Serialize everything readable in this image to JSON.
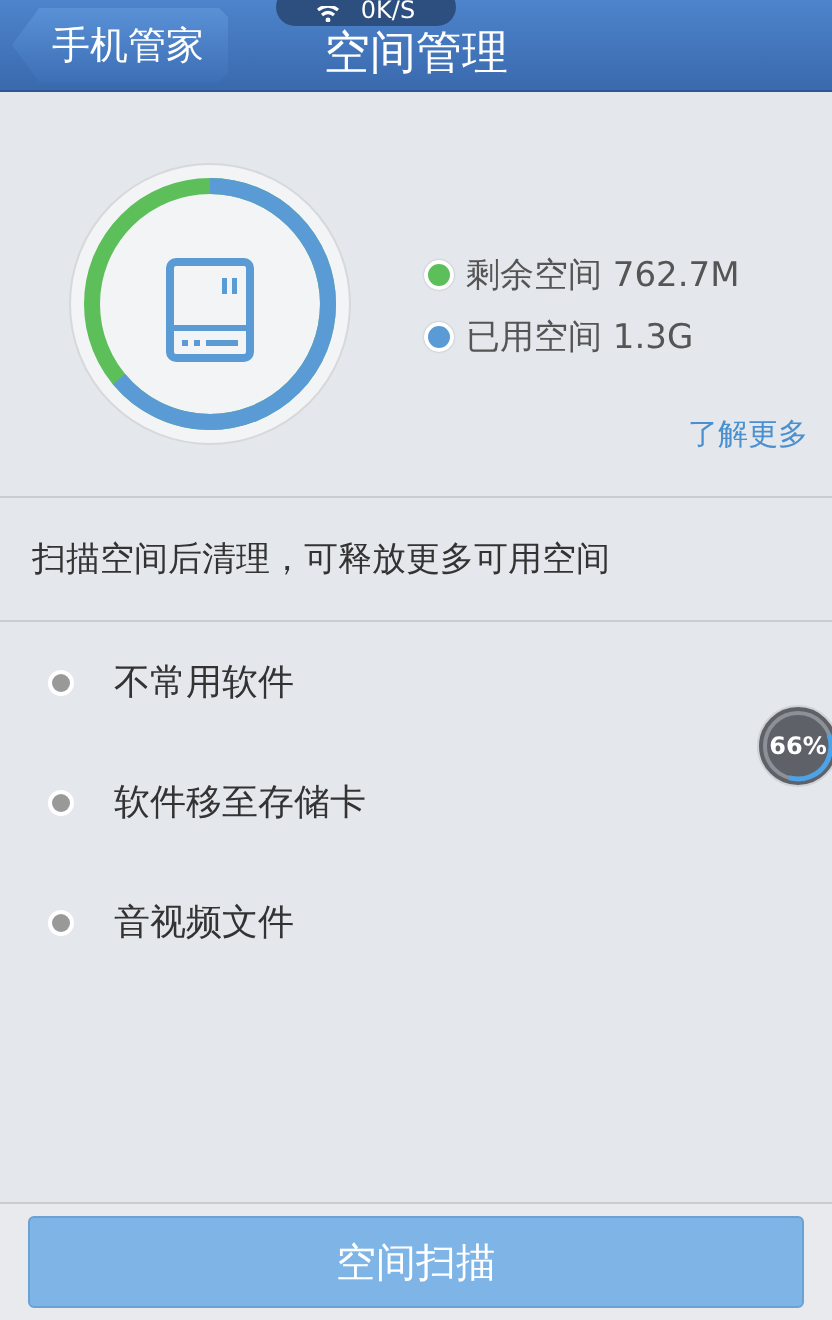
{
  "header": {
    "back": "手机管家",
    "title": "空间管理"
  },
  "speed_widget": {
    "text": "0K/S"
  },
  "storage": {
    "level": 0.64,
    "legend": [
      {
        "label": "剩余空间 762.7M",
        "color": "#5cbf5a"
      },
      {
        "label": "已用空间 1.3G",
        "color": "#5b9bd5"
      }
    ],
    "more_link": "了解更多"
  },
  "hint": "扫描空间后清理，可释放更多可用空间",
  "items": [
    {
      "label": "不常用软件"
    },
    {
      "label": "软件移至存储卡"
    },
    {
      "label": "音视频文件"
    }
  ],
  "memory_widget": {
    "text": "66%",
    "level": 0.35
  },
  "scan_button": "空间扫描"
}
